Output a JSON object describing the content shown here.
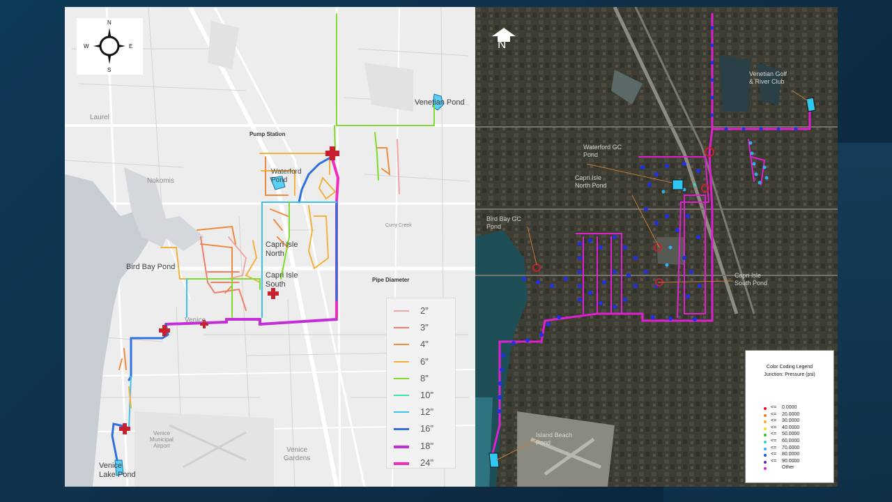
{
  "left_map": {
    "compass": {
      "n": "N",
      "s": "S",
      "e": "E",
      "w": "W"
    },
    "places": {
      "laurel": "Laurel",
      "nokomis": "Nokomis",
      "venice": "Venice",
      "venice_gardens": "Venice\nGardens",
      "venice_airport": "Venice\nMunicipal\nAirport",
      "curry_creek": "Curry Creek",
      "pump_station": "Pump Station",
      "pipe_diameter": "Pipe Diameter",
      "venetian_pond": "Venetian Pond",
      "waterford_pond": "Waterford\nPond",
      "capri_north": "Capri Isle\nNorth",
      "capri_south": "Capri Isle\nSouth",
      "bird_bay_pond": "Bird Bay Pond",
      "venice_lake_pond": "Venice\nLake Pond"
    },
    "pipe_legend": [
      {
        "size": "2\"",
        "color": "#f2a5a5",
        "width": 2
      },
      {
        "size": "3\"",
        "color": "#ef7f6a",
        "width": 2
      },
      {
        "size": "4\"",
        "color": "#ef8a3e",
        "width": 2
      },
      {
        "size": "6\"",
        "color": "#f2b13d",
        "width": 2
      },
      {
        "size": "8\"",
        "color": "#7edc2c",
        "width": 2
      },
      {
        "size": "10\"",
        "color": "#3de0b4",
        "width": 2
      },
      {
        "size": "12\"",
        "color": "#3ec1f2",
        "width": 2
      },
      {
        "size": "16\"",
        "color": "#2f6fdf",
        "width": 3
      },
      {
        "size": "18\"",
        "color": "#c22fd6",
        "width": 4
      },
      {
        "size": "24\"",
        "color": "#f02bbd",
        "width": 4
      }
    ]
  },
  "right_map": {
    "north_label": "N",
    "places": {
      "venetian_golf": "Venetian Golf\n& River Club",
      "waterford_gc": "Waterford GC\nPond",
      "capri_north": "Capri Isle\nNorth Pond",
      "bird_bay_gc": "Bird Bay GC\nPond",
      "capri_south": "Capri Isle\nSouth Pond",
      "island_beach": "Island Beach\nPond"
    },
    "pressure_legend": {
      "title_1": "Color Coding Legend",
      "title_2": "Junction: Pressure (psi)",
      "rows": [
        {
          "op": "<=",
          "value": "0.0000",
          "color": "#e01010"
        },
        {
          "op": "<=",
          "value": "20.0000",
          "color": "#f07820"
        },
        {
          "op": "<=",
          "value": "30.0000",
          "color": "#f0b020"
        },
        {
          "op": "<=",
          "value": "40.0000",
          "color": "#e8e020"
        },
        {
          "op": "<=",
          "value": "50.0000",
          "color": "#30c030"
        },
        {
          "op": "<=",
          "value": "60.0000",
          "color": "#30d8c0"
        },
        {
          "op": "<=",
          "value": "70.0000",
          "color": "#30b0f0"
        },
        {
          "op": "<=",
          "value": "80.0000",
          "color": "#2050e0"
        },
        {
          "op": "<=",
          "value": "90.0000",
          "color": "#6020c0"
        },
        {
          "op": "",
          "value": "Other",
          "color": "#e020d0"
        }
      ]
    }
  }
}
